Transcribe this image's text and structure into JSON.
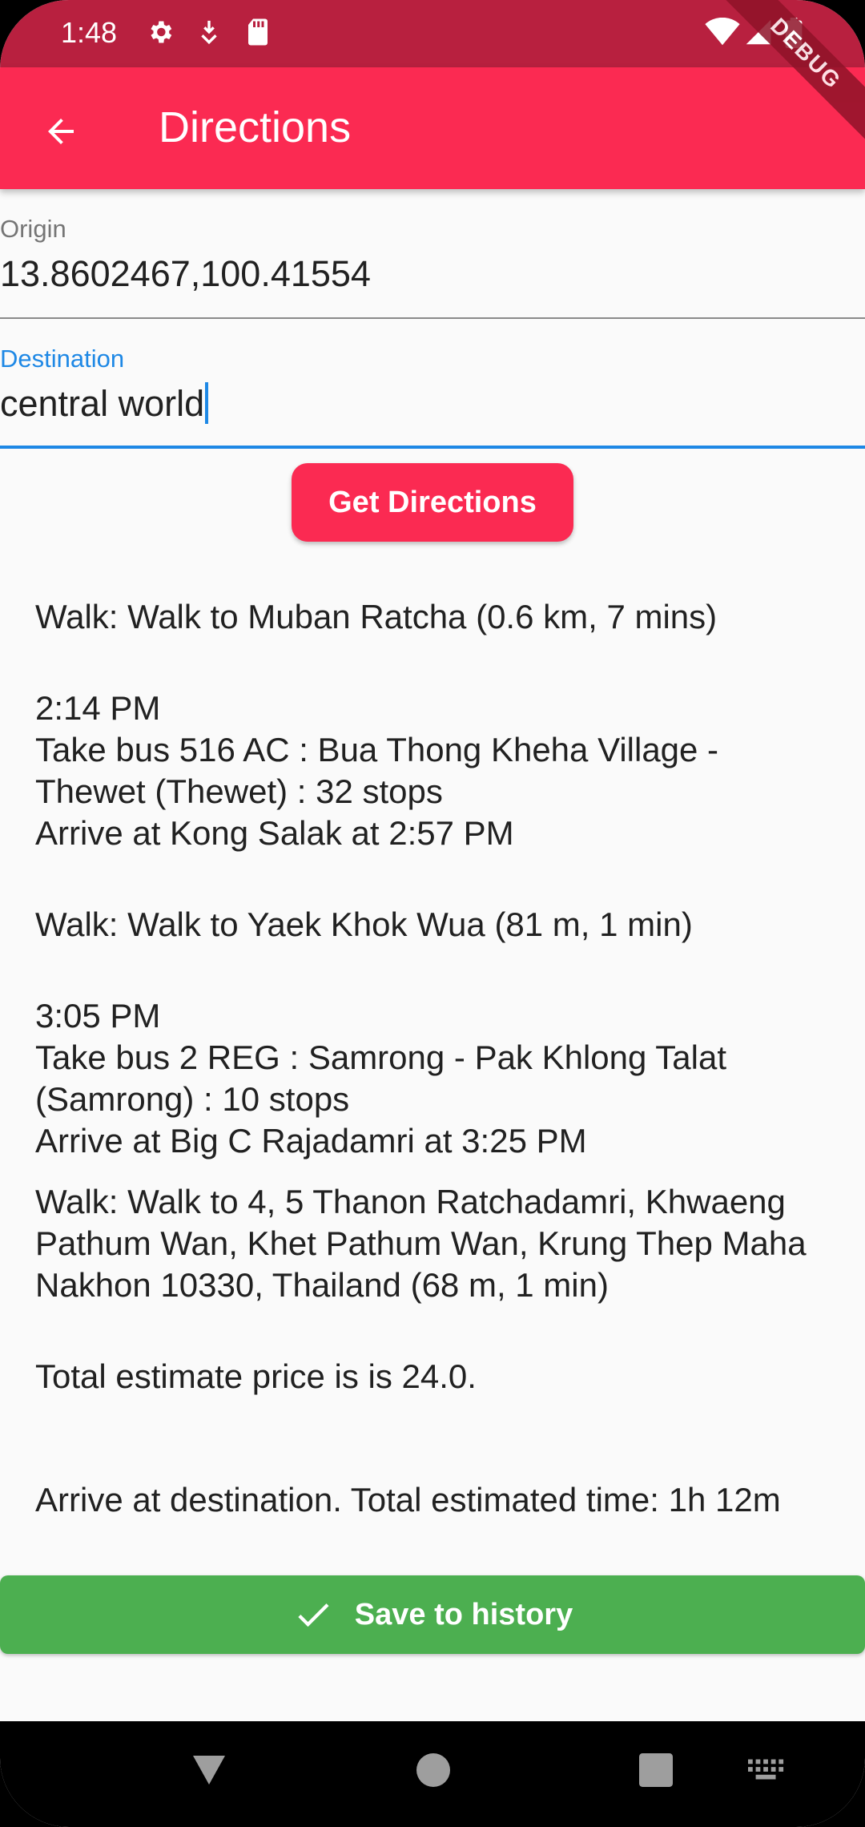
{
  "status_bar": {
    "time": "1:48",
    "colors": {
      "background": "#b8203f"
    },
    "left_icons": [
      "gear-icon",
      "download-icon",
      "sd-card-icon"
    ],
    "right_icons": [
      "wifi-icon",
      "signal-icon",
      "battery-icon"
    ]
  },
  "app_bar": {
    "title": "Directions",
    "back_icon": "arrow-back-icon",
    "debug_banner": "DEBUG",
    "color": "#fb2a52"
  },
  "form": {
    "origin": {
      "label": "Origin",
      "value": "13.8602467,100.41554"
    },
    "destination": {
      "label": "Destination",
      "value": "central world",
      "focused": true,
      "accent": "#1e88e5"
    },
    "get_directions_label": "Get Directions"
  },
  "directions": {
    "steps": [
      {
        "lines": [
          "Walk: Walk to Muban Ratcha (0.6 km, 7 mins)"
        ]
      },
      {
        "lines": [
          "2:14 PM",
          "Take bus 516 AC : Bua Thong Kheha Village -",
          "Thewet (Thewet) : 32 stops",
          "Arrive at Kong Salak at 2:57 PM"
        ]
      },
      {
        "lines": [
          "Walk: Walk to Yaek Khok Wua (81 m, 1 min)"
        ]
      },
      {
        "lines": [
          "3:05 PM",
          "Take bus 2 REG : Samrong - Pak Khlong Talat",
          "(Samrong) : 10 stops",
          "Arrive at Big C Rajadamri at 3:25 PM"
        ]
      },
      {
        "lines": [
          "Walk: Walk to 4, 5 Thanon Ratchadamri, Khwaeng",
          "Pathum Wan, Khet Pathum Wan, Krung Thep Maha",
          "Nakhon 10330, Thailand (68 m, 1 min)"
        ]
      }
    ],
    "total_price": "Total estimate price is is 24.0.",
    "total_time": "Arrive at destination. Total estimated time: 1h 12m"
  },
  "save_button": {
    "label": "Save to history",
    "icon": "check-icon",
    "color": "#4caf50"
  },
  "nav_bar": {
    "items": [
      "back-triangle-icon",
      "home-circle-icon",
      "recents-square-icon",
      "keyboard-icon"
    ]
  }
}
